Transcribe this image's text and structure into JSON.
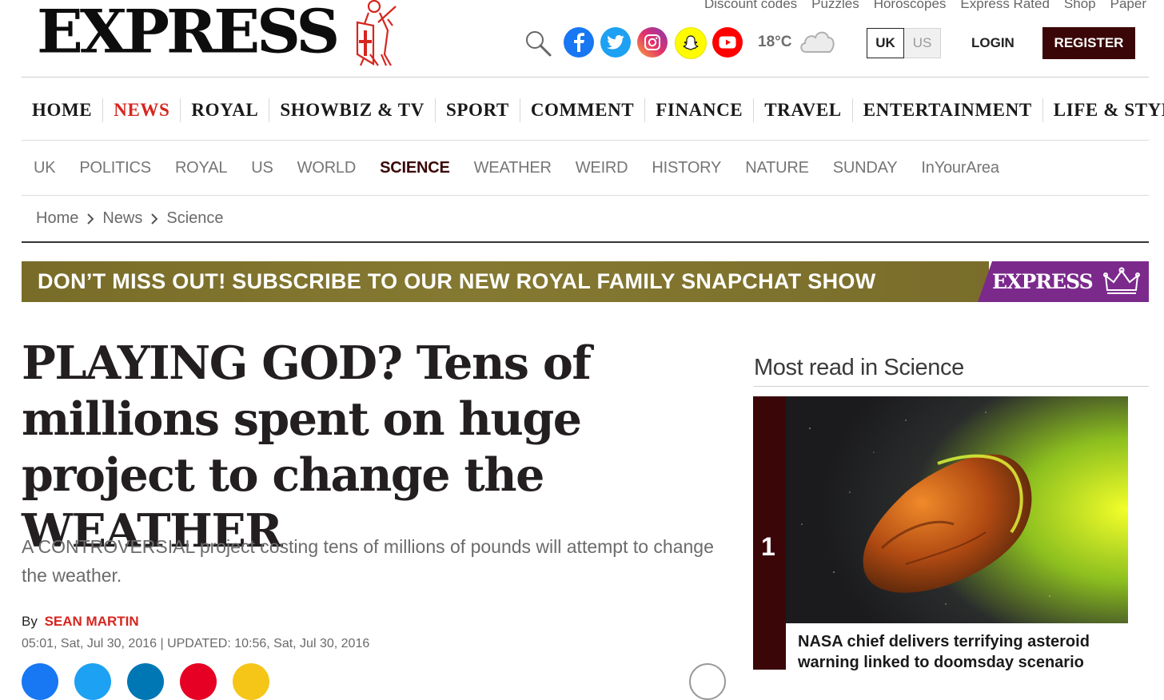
{
  "header": {
    "logo_text": "EXPRESS",
    "top_links": [
      "Discount codes",
      "Puzzles",
      "Horoscopes",
      "Express Rated",
      "Shop",
      "Paper"
    ],
    "social_icons": [
      "facebook-icon",
      "twitter-icon",
      "instagram-icon",
      "snapchat-icon",
      "youtube-icon"
    ],
    "weather": {
      "temperature": "18°C",
      "icon": "cloud-icon"
    },
    "edition": {
      "uk": "UK",
      "us": "US",
      "selected": "UK"
    },
    "login_label": "LOGIN",
    "register_label": "REGISTER"
  },
  "main_nav": {
    "items": [
      "HOME",
      "NEWS",
      "ROYAL",
      "SHOWBIZ & TV",
      "SPORT",
      "COMMENT",
      "FINANCE",
      "TRAVEL",
      "ENTERTAINMENT",
      "LIFE & STYLE"
    ],
    "active": "NEWS"
  },
  "sub_nav": {
    "items": [
      "UK",
      "POLITICS",
      "ROYAL",
      "US",
      "WORLD",
      "SCIENCE",
      "WEATHER",
      "WEIRD",
      "HISTORY",
      "NATURE",
      "SUNDAY",
      "InYourArea"
    ],
    "active": "SCIENCE"
  },
  "breadcrumb": [
    "Home",
    "News",
    "Science"
  ],
  "banner": {
    "text": "DON’T MISS OUT! SUBSCRIBE TO OUR NEW ROYAL FAMILY SNAPCHAT SHOW",
    "brand": "EXPRESS"
  },
  "article": {
    "headline": "PLAYING GOD? Tens of millions spent on huge project to change the WEATHER",
    "standfirst": "A CONTROVERSIAL project costing tens of millions of pounds will attempt to change the weather.",
    "by_label": "By",
    "author": "SEAN MARTIN",
    "dateline": "05:01, Sat, Jul 30, 2016 | UPDATED: 10:56, Sat, Jul 30, 2016"
  },
  "sidebar": {
    "title": "Most read in Science",
    "items": [
      {
        "rank": "1",
        "title": "NASA chief delivers terrifying asteroid warning linked to doomsday scenario"
      }
    ]
  },
  "colors": {
    "brand_red": "#d6261f",
    "brand_maroon": "#3a0607",
    "banner_gold": "#7f7430",
    "banner_purple": "#7b2a8c"
  }
}
